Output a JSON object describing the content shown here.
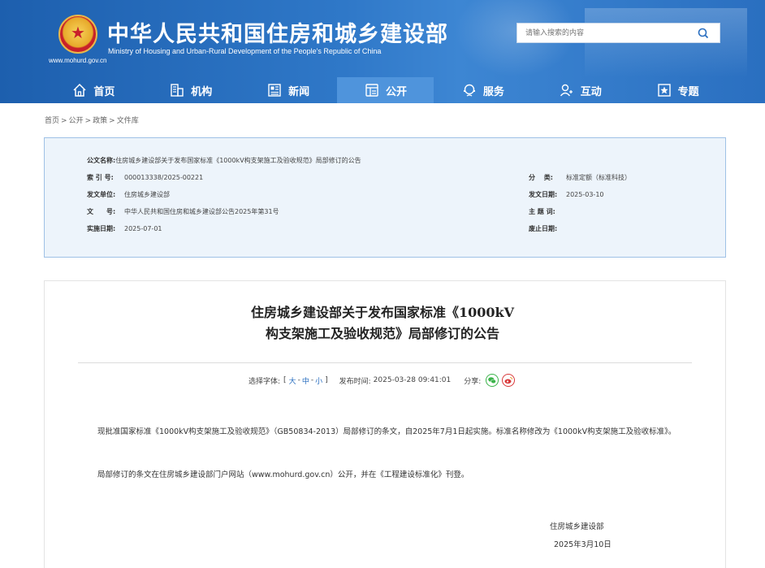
{
  "header": {
    "title": "中华人民共和国住房和城乡建设部",
    "subtitle": "Ministry of Housing and Urban-Rural Development of the People's Republic of China",
    "url": "www.mohurd.gov.cn",
    "search_placeholder": "请输入搜索的内容"
  },
  "nav": {
    "items": [
      {
        "label": "首页",
        "icon": "home-icon"
      },
      {
        "label": "机构",
        "icon": "building-icon"
      },
      {
        "label": "新闻",
        "icon": "news-icon"
      },
      {
        "label": "公开",
        "icon": "open-icon"
      },
      {
        "label": "服务",
        "icon": "service-icon"
      },
      {
        "label": "互动",
        "icon": "interact-icon"
      },
      {
        "label": "专题",
        "icon": "topic-icon"
      }
    ],
    "active": "公开"
  },
  "breadcrumb": [
    "首页",
    "公开",
    "政策",
    "文件库"
  ],
  "info": {
    "doc_name_label": "公文名称:",
    "doc_name": "住房城乡建设部关于发布国家标准《1000kV构支架施工及验收规范》局部修订的公告",
    "index_label": "索 引 号:",
    "index": "000013338/2025-00221",
    "category_label": "分　 类:",
    "category": "标准定额（标准科技）",
    "issuer_label": "发文单位:",
    "issuer": "住房城乡建设部",
    "issue_date_label": "发文日期:",
    "issue_date": "2025-03-10",
    "doc_no_label": "文　　号:",
    "doc_no": "中华人民共和国住房和城乡建设部公告2025年第31号",
    "subject_label": "主 题 词:",
    "subject": "",
    "effective_label": "实施日期:",
    "effective": "2025-07-01",
    "repeal_label": "废止日期:",
    "repeal": ""
  },
  "article": {
    "title_line1": "住房城乡建设部关于发布国家标准《1000kV",
    "title_line2": "构支架施工及验收规范》局部修订的公告",
    "font_label": "选择字体:",
    "font_open": "[",
    "font_large": "大",
    "font_medium": "中",
    "font_small": "小",
    "font_close": "]",
    "font_dash": "-",
    "publish_label": "发布时间:",
    "publish_time": "2025-03-28 09:41:01",
    "share_label": "分享:",
    "paragraph1": "现批准国家标准《1000kV构支架施工及验收规范》（GB50834-2013）局部修订的条文，自2025年7月1日起实施。标准名称修改为《1000kV构支架施工及验收标准》。",
    "paragraph2": "局部修订的条文在住房城乡建设部门户网站（www.mohurd.gov.cn）公开，并在《工程建设标准化》刊登。",
    "signature": "住房城乡建设部",
    "sign_date": "2025年3月10日"
  },
  "colors": {
    "header_blue": "#2f78c8",
    "nav_active": "#4f94dc",
    "infobox_bg": "#edf4fb"
  }
}
